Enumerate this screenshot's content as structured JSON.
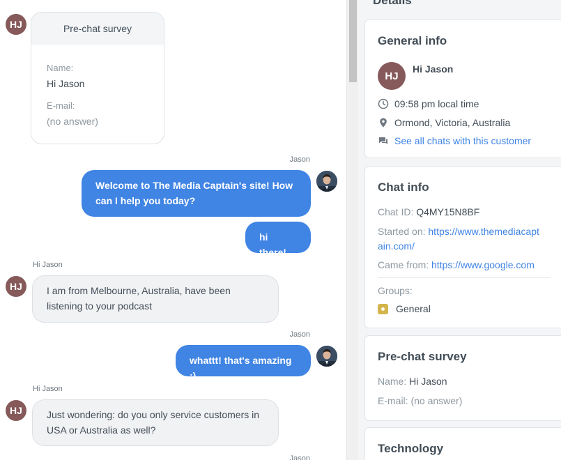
{
  "chat": {
    "visitor_initials": "HJ",
    "survey_card": {
      "title": "Pre-chat survey",
      "name_label": "Name:",
      "name_value": "Hi Jason",
      "email_label": "E-mail:",
      "email_value": "(no answer)"
    },
    "messages": [
      {
        "sender": "Jason",
        "lines": [
          "Welcome to The Media Captain's site! How",
          "can I help you today?"
        ]
      },
      {
        "sender": "",
        "lines": [
          "hi there!"
        ]
      },
      {
        "sender": "Hi Jason",
        "lines": [
          "I am from Melbourne, Australia, have been",
          "listening to your podcast"
        ]
      },
      {
        "sender": "Jason",
        "lines": [
          "whattt! that's amazing :)"
        ]
      },
      {
        "sender": "Hi Jason",
        "lines": [
          "Just wondering: do you only service customers in",
          "USA or Australia as well?"
        ]
      },
      {
        "sender": "Jason",
        "lines": []
      }
    ]
  },
  "details": {
    "title": "Details",
    "general_info": {
      "title": "General info",
      "avatar_initials": "HJ",
      "name": "Hi Jason",
      "local_time": "09:58 pm local time",
      "location": "Ormond, Victoria, Australia",
      "see_all_chats": "See all chats with this customer"
    },
    "chat_info": {
      "title": "Chat info",
      "chat_id_label": "Chat ID:",
      "chat_id_value": "Q4MY15N8BF",
      "started_on_label": "Started on:",
      "started_on_line1": "https://www.themediacapt",
      "started_on_line2": "ain.com/",
      "came_from_label": "Came from:",
      "came_from_value": "https://www.google.com",
      "groups_label": "Groups:",
      "group_name": "General"
    },
    "pre_chat_survey": {
      "title": "Pre-chat survey",
      "name_label": "Name:",
      "name_value": "Hi Jason",
      "email_label": "E-mail:",
      "email_value": "(no answer)"
    },
    "technology": {
      "title": "Technology"
    }
  },
  "colors": {
    "agent_bubble": "#4084e4",
    "visitor_bubble": "#f1f2f4",
    "avatar_visitor": "#86595a",
    "link": "#4084e4",
    "group_tag": "#d4b44c"
  },
  "icons": [
    "clock-icon",
    "location-pin-icon",
    "chat-bubble-icon",
    "group-tag-icon"
  ]
}
